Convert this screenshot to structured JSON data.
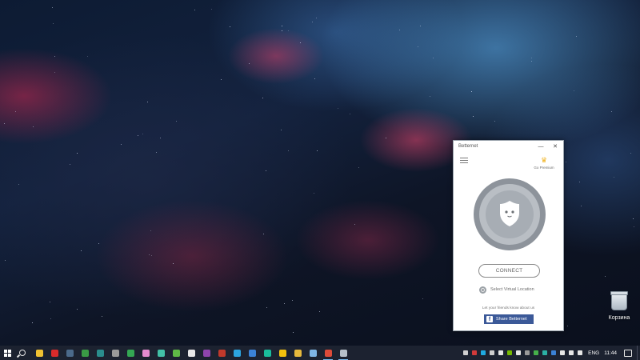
{
  "desktop": {
    "recycle_bin_label": "Корзина"
  },
  "betternet": {
    "window_title": "Betternet",
    "minimize_symbol": "—",
    "close_symbol": "✕",
    "premium_label": "Go Premium",
    "premium_icon": "crown-icon",
    "connect_label": "CONNECT",
    "select_location_label": "Select Virtual Location",
    "share_prompt": "Let your friends know about us",
    "share_button_label": "Share Betternet",
    "colors": {
      "facebook_blue": "#3b5998",
      "shield_outer": "#8d939b",
      "shield_ring": "#b9bec4",
      "premium_crown": "#f0b323"
    }
  },
  "taskbar": {
    "apps": [
      {
        "name": "taskbar-app-explorer-yellow",
        "color": "#f1c232",
        "active": false
      },
      {
        "name": "taskbar-app-filezilla",
        "color": "#d92b2b",
        "active": false
      },
      {
        "name": "taskbar-app-steam",
        "color": "#4b6a8a",
        "active": false
      },
      {
        "name": "taskbar-app-green",
        "color": "#3a9b45",
        "active": false
      },
      {
        "name": "taskbar-app-teal",
        "color": "#2a8d8d",
        "active": false
      },
      {
        "name": "taskbar-app-gray",
        "color": "#9a9a9a",
        "active": false
      },
      {
        "name": "taskbar-app-chrome-green",
        "color": "#34a853",
        "active": false
      },
      {
        "name": "taskbar-app-pink",
        "color": "#e48bd0",
        "active": false
      },
      {
        "name": "taskbar-app-network",
        "color": "#42c0a6",
        "active": false
      },
      {
        "name": "taskbar-app-utorrent",
        "color": "#5fba46",
        "active": false
      },
      {
        "name": "taskbar-app-epic",
        "color": "#e8e8e8",
        "active": false
      },
      {
        "name": "taskbar-app-purple",
        "color": "#8e44ad",
        "active": false
      },
      {
        "name": "taskbar-app-red-t",
        "color": "#c0392b",
        "active": false
      },
      {
        "name": "taskbar-app-telegram",
        "color": "#2ca5e0",
        "active": false
      },
      {
        "name": "taskbar-app-blue",
        "color": "#3b82d6",
        "active": false
      },
      {
        "name": "taskbar-app-cyan",
        "color": "#1abc9c",
        "active": false
      },
      {
        "name": "taskbar-app-star",
        "color": "#f4c20d",
        "active": false
      },
      {
        "name": "taskbar-app-folder",
        "color": "#e6b93d",
        "active": false
      },
      {
        "name": "taskbar-app-notepad",
        "color": "#7fb6e6",
        "active": false
      },
      {
        "name": "taskbar-app-chrome",
        "color": "#dd4b39",
        "active": true
      },
      {
        "name": "taskbar-app-betternet",
        "color": "#b7c0c9",
        "active": true
      }
    ],
    "tray_icons": [
      {
        "name": "tray-circle-icon",
        "color": "#d0d0d0"
      },
      {
        "name": "tray-red-icon",
        "color": "#d23a3a"
      },
      {
        "name": "tray-skype-icon",
        "color": "#1faae1"
      },
      {
        "name": "tray-arrow-icon",
        "color": "#cfcfcf"
      },
      {
        "name": "tray-gallery-icon",
        "color": "#e6e6e6"
      },
      {
        "name": "tray-nvidia-icon",
        "color": "#76b900"
      },
      {
        "name": "tray-cloud-icon",
        "color": "#e6e6e6"
      },
      {
        "name": "tray-folder-icon",
        "color": "#9a9a9a"
      },
      {
        "name": "tray-green-icon",
        "color": "#46b04a"
      },
      {
        "name": "tray-teal-icon",
        "color": "#2bb0a5"
      },
      {
        "name": "tray-bluetooth-icon",
        "color": "#3b82d6"
      },
      {
        "name": "tray-network-icon",
        "color": "#e6e6e6"
      },
      {
        "name": "tray-speaker-icon",
        "color": "#e6e6e6"
      },
      {
        "name": "tray-battery-icon",
        "color": "#e6e6e6"
      }
    ],
    "language": "ENG",
    "time": "11:44"
  }
}
